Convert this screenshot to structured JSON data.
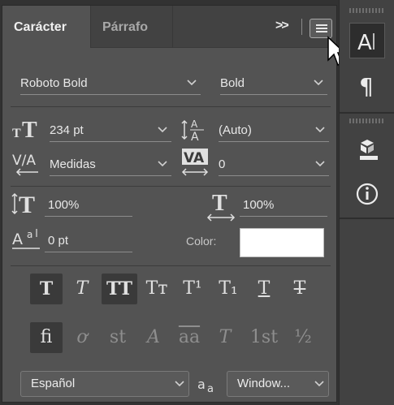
{
  "tabs": [
    {
      "label": "Carácter"
    },
    {
      "label": "Párrafo"
    }
  ],
  "tab_expand": ">>",
  "font": {
    "family": "Roboto Bold",
    "style": "Bold"
  },
  "size": {
    "value": "234 pt"
  },
  "leading": {
    "value": "(Auto)"
  },
  "kerning": {
    "value": "Medidas"
  },
  "tracking": {
    "value": "0"
  },
  "vertical_scale": {
    "value": "100%"
  },
  "horizontal_scale": {
    "value": "100%"
  },
  "baseline_shift": {
    "value": "0 pt"
  },
  "color": {
    "label": "Color:",
    "value": "#ffffff"
  },
  "style_buttons": [
    "T",
    "T",
    "TT",
    "Tт",
    "T¹",
    "T₁",
    "T",
    "T"
  ],
  "opentype_buttons": [
    "fi",
    "ơ",
    "st",
    "A",
    "aa",
    "T",
    "1st",
    "½"
  ],
  "language": {
    "value": "Español"
  },
  "antialias": {
    "value": "Window..."
  },
  "dock": {
    "items": [
      "character-panel",
      "paragraph-panel",
      "libraries-panel",
      "info-panel"
    ]
  }
}
